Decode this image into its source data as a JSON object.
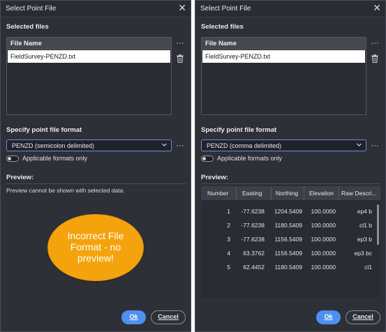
{
  "left_dialog": {
    "title": "Select Point File",
    "close_glyph": "✕",
    "selected_files_label": "Selected files",
    "file_name_header": "File Name",
    "file_name": "FieldSurvey-PENZD.txt",
    "more_glyph": "···",
    "format_label": "Specify point file format",
    "format_value": "PENZD (semicolon delimited)",
    "toggle_label": "Applicable formats only",
    "toggle_on": false,
    "preview_label": "Preview:",
    "preview_message": "Preview cannot be shown with selected data.",
    "callout_line1": "Incorrect File",
    "callout_line2": "Format - no",
    "callout_line3": "preview!",
    "ok_label": "Ok",
    "cancel_label": "Cancel",
    "callout_color": "#f5a30c"
  },
  "right_dialog": {
    "title": "Select Point File",
    "close_glyph": "✕",
    "selected_files_label": "Selected files",
    "file_name_header": "File Name",
    "file_name": "FieldSurvey-PENZD.txt",
    "more_glyph": "···",
    "format_label": "Specify point file format",
    "format_value": "PENZD (comma delimited)",
    "toggle_label": "Applicable formats only",
    "toggle_on": false,
    "preview_label": "Preview:",
    "table": {
      "headers": [
        "Number",
        "Easting",
        "Northing",
        "Elevation",
        "Raw Descri..."
      ],
      "rows": [
        [
          "1",
          "-77.6238",
          "1204.5409",
          "100.0000",
          "ep4 b"
        ],
        [
          "2",
          "-77.6238",
          "1180.5409",
          "100.0000",
          "cl1 b"
        ],
        [
          "3",
          "-77.6238",
          "1156.5409",
          "100.0000",
          "ep3 b"
        ],
        [
          "4",
          "63.3762",
          "1156.5409",
          "100.0000",
          "ep3 bc"
        ],
        [
          "5",
          "62.4452",
          "1180.5409",
          "100.0000",
          "cl1"
        ]
      ]
    },
    "ok_label": "Ok",
    "cancel_label": "Cancel"
  },
  "colors": {
    "dialog_bg": "#2e3038",
    "accent": "#4f8ff2",
    "callout": "#f5a30c"
  },
  "icons": {
    "close": "close-icon",
    "trash": "trash-icon",
    "more": "more-icon",
    "chevron": "chevron-down-icon"
  }
}
